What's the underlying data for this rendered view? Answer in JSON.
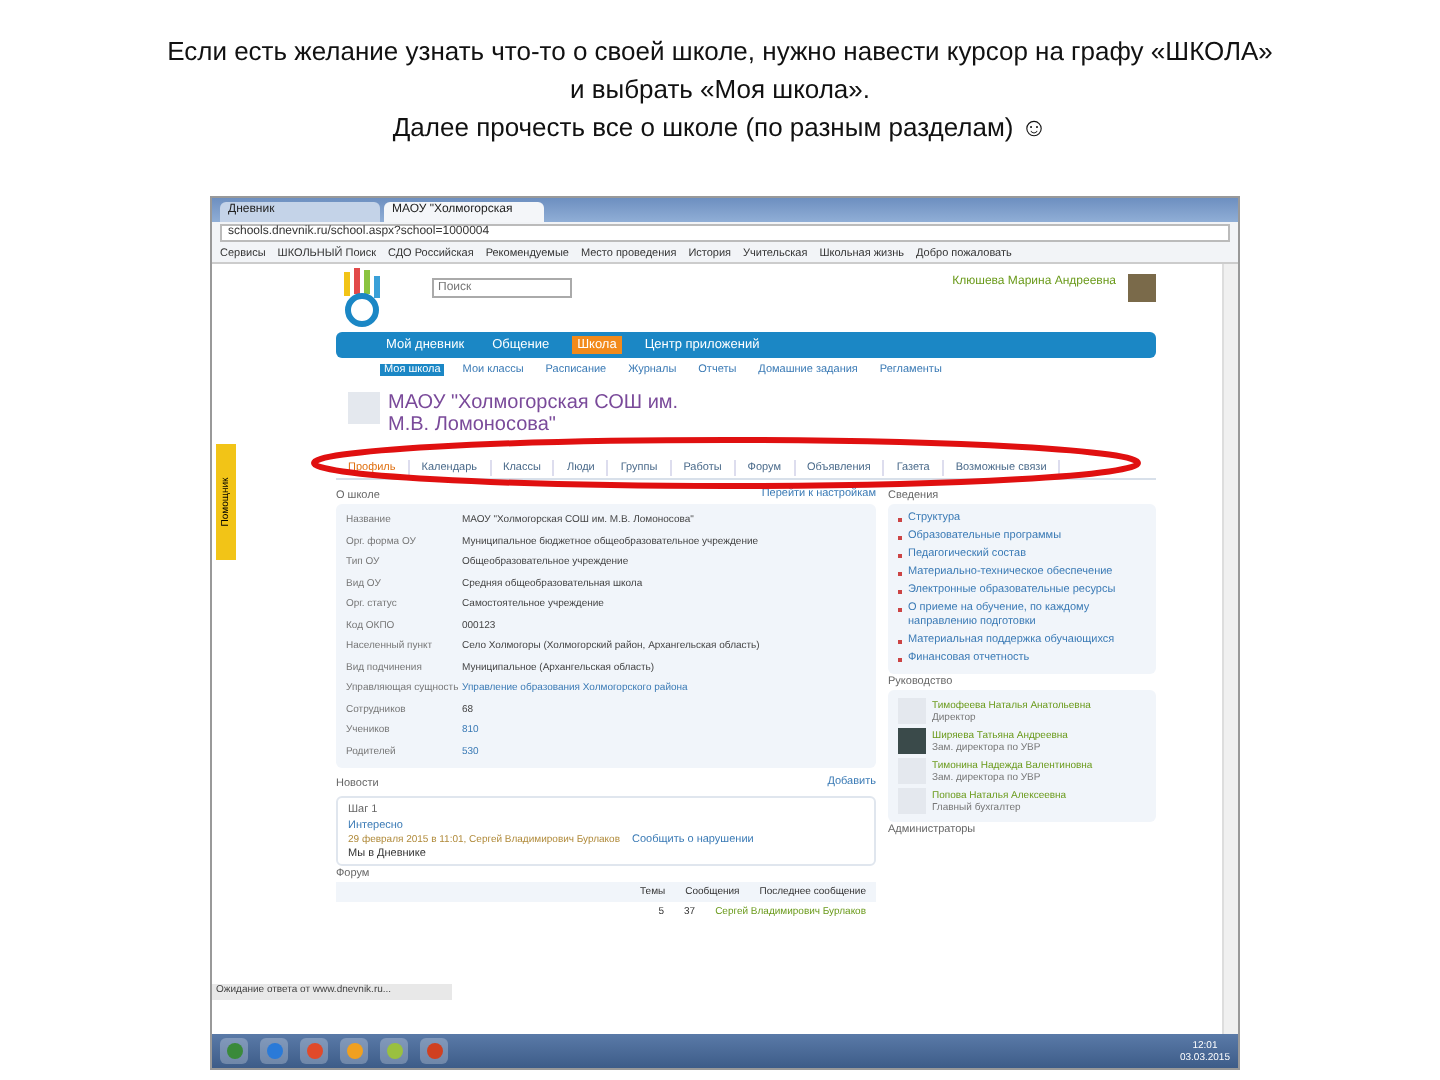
{
  "caption": [
    "Если есть желание узнать что-то о своей школе, нужно навести курсор на графу «ШКОЛА»",
    "и выбрать «Моя школа».",
    "Далее прочесть все о школе (по разным разделам) ☺"
  ],
  "browser": {
    "tabs": [
      {
        "label": "Дневник",
        "selected": false
      },
      {
        "label": "МАОУ \"Холмогорская",
        "selected": true
      }
    ],
    "url": "schools.dnevnik.ru/school.aspx?school=1000004",
    "bookmarks": [
      "Сервисы",
      "ШКОЛЬНЫЙ Поиск",
      "СДО Российская",
      "Рекомендуемые",
      "Место проведения",
      "История",
      "Учительская",
      "Школьная жизнь",
      "Добро пожаловать"
    ]
  },
  "site": {
    "search": {
      "placeholder": "Поиск"
    },
    "user": "Клюшева Марина Андреевна",
    "nav": [
      {
        "label": "Мой дневник",
        "selected": false
      },
      {
        "label": "Общение",
        "selected": false
      },
      {
        "label": "Школа",
        "selected": true
      },
      {
        "label": "Центр приложений",
        "selected": false
      }
    ],
    "subnav": [
      {
        "label": "Моя школа",
        "selected": true
      },
      {
        "label": "Мои классы",
        "selected": false
      },
      {
        "label": "Расписание",
        "selected": false
      },
      {
        "label": "Журналы",
        "selected": false
      },
      {
        "label": "Отчеты",
        "selected": false
      },
      {
        "label": "Домашние задания",
        "selected": false
      },
      {
        "label": "Регламенты",
        "selected": false
      }
    ],
    "school_title": "МАОУ \"Холмогорская СОШ им. М.В. Ломоносова\"",
    "tabs": [
      {
        "label": "Профиль",
        "selected": true
      },
      {
        "label": "Календарь",
        "selected": false
      },
      {
        "label": "Классы",
        "selected": false
      },
      {
        "label": "Люди",
        "selected": false
      },
      {
        "label": "Группы",
        "selected": false
      },
      {
        "label": "Работы",
        "selected": false
      },
      {
        "label": "Форум",
        "selected": false
      },
      {
        "label": "Объявления",
        "selected": false
      },
      {
        "label": "Газета",
        "selected": false
      },
      {
        "label": "Возможные связи",
        "selected": false
      }
    ],
    "helper": "Помощник",
    "profile_header": "О школе",
    "profile_link": "Перейти к настройкам",
    "profile": [
      {
        "label": "Название",
        "value": "МАОУ \"Холмогорская СОШ им. М.В. Ломоносова\""
      },
      {
        "label": "Орг. форма ОУ",
        "value": "Муниципальное бюджетное общеобразовательное учреждение"
      },
      {
        "label": "Тип ОУ",
        "value": "Общеобразовательное учреждение"
      },
      {
        "label": "Вид ОУ",
        "value": "Средняя общеобразовательная школа"
      },
      {
        "label": "Орг. статус",
        "value": "Самостоятельное учреждение"
      },
      {
        "label": "Код ОКПО",
        "value": "000123"
      },
      {
        "label": "Населенный пункт",
        "value": "Село Холмогоры (Холмогорский район, Архангельская область)"
      },
      {
        "label": "Вид подчинения",
        "value": "Муниципальное (Архангельская область)"
      },
      {
        "label": "Управляющая сущность",
        "value": "Управление образования Холмогорского района",
        "kind": "link"
      },
      {
        "label": "Сотрудников",
        "value": "68"
      },
      {
        "label": "Учеников",
        "value": "810",
        "kind": "link"
      },
      {
        "label": "Родителей",
        "value": "530",
        "kind": "link"
      }
    ],
    "info_header": "Сведения",
    "info": [
      "Структура",
      "Образовательные программы",
      "Педагогический состав",
      "Материально-техническое обеспечение",
      "Электронные образовательные ресурсы",
      "О приеме на обучение, по каждому направлению подготовки",
      "Материальная поддержка обучающихся",
      "Финансовая отчетность"
    ],
    "staff_header": "Руководство",
    "staff": [
      {
        "name": "Тимофеева Наталья Анатольевна",
        "role": "Директор",
        "photo": false
      },
      {
        "name": "Ширяева Татьяна Андреевна",
        "role": "Зам. директора по УВР",
        "photo": true
      },
      {
        "name": "Тимонина Надежда Валентиновна",
        "role": "Зам. директора по УВР",
        "photo": false
      },
      {
        "name": "Попова Наталья Алексеевна",
        "role": "Главный бухгалтер",
        "photo": false
      }
    ],
    "admin_header": "Администраторы",
    "news": {
      "title": "Новости",
      "add": "Добавить",
      "label": "Шаг 1",
      "headline": "Интересно",
      "meta": "29 февраля 2015 в 11:01, Сергей Владимирович Бурлаков",
      "report": "Сообщить о нарушении",
      "text": "Мы в Дневнике"
    },
    "forum": {
      "title": "Форум",
      "columns": [
        "Темы",
        "Сообщения",
        "Последнее сообщение"
      ],
      "row": [
        "5",
        "37",
        "Сергей Владимирович Бурлаков"
      ]
    },
    "status": "Ожидание ответа от www.dnevnik.ru...",
    "clock": {
      "time": "12:01",
      "date": "03.03.2015"
    }
  }
}
